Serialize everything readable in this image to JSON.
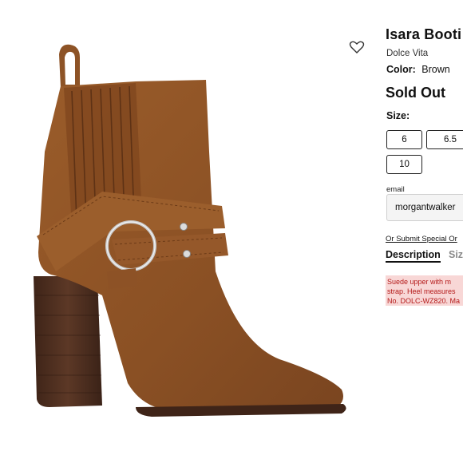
{
  "product": {
    "title": "Isara Booti",
    "brand": "Dolce Vita",
    "color_label": "Color:",
    "color_value": "Brown",
    "status": "Sold Out"
  },
  "size": {
    "label": "Size:",
    "options": [
      "6",
      "6.5",
      "10"
    ]
  },
  "notify": {
    "email_label": "email",
    "email_value": "morgantwalker",
    "special_order_link": "Or Submit Special Or"
  },
  "tabs": {
    "description": "Description",
    "size_fit": "Siz"
  },
  "description_lines": [
    "Suede upper with m",
    "strap. Heel measures",
    "No. DOLC-WZ820. Ma"
  ],
  "colors": {
    "suede": "#8f5424",
    "heel": "#4d2e1f",
    "description_bg": "#f8d7d6",
    "description_text": "#b41a1a"
  }
}
